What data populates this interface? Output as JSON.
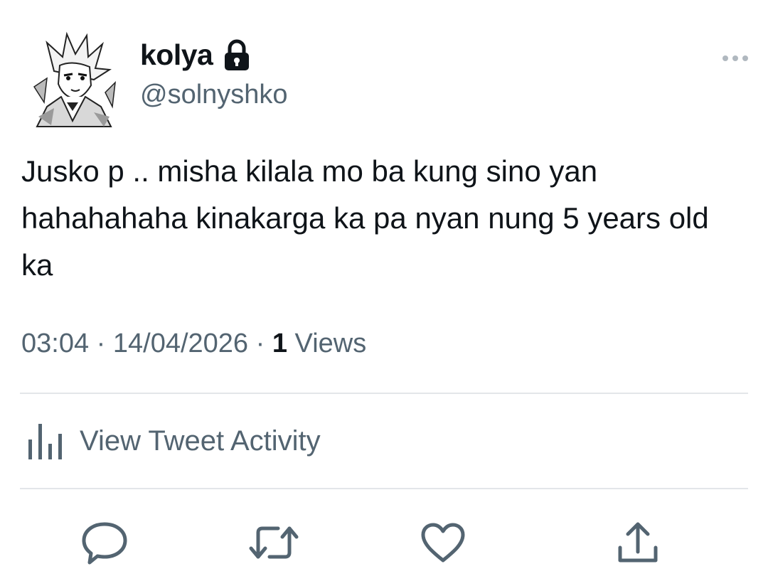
{
  "user": {
    "display_name": "kolya",
    "handle": "@solnyshko",
    "protected_icon": "lock-icon",
    "avatar_icon": "avatar-anime-illustration"
  },
  "tweet": {
    "text": "Jusko p .. misha kilala mo ba kung sino yan hahahahaha kinakarga ka pa nyan nung 5 years old ka",
    "time": "03:04",
    "separator": "·",
    "date": "14/04/2026",
    "views_count": "1",
    "views_label": "Views"
  },
  "activity": {
    "label": "View Tweet Activity",
    "icon": "bar-chart-icon"
  },
  "actions": [
    {
      "name": "reply",
      "icon": "reply-icon"
    },
    {
      "name": "retweet",
      "icon": "retweet-icon"
    },
    {
      "name": "like",
      "icon": "heart-icon"
    },
    {
      "name": "share",
      "icon": "share-icon"
    }
  ],
  "colors": {
    "text_primary": "#0f1419",
    "text_secondary": "#536471",
    "divider": "#e3e6e9",
    "icon": "#536471"
  }
}
